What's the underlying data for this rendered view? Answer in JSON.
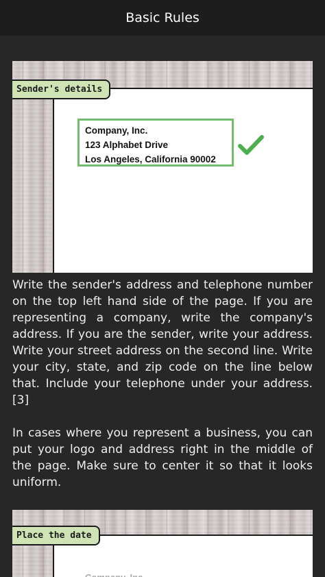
{
  "app_bar": {
    "title": "Basic Rules"
  },
  "sections": [
    {
      "tag": "Sender's details",
      "address_lines": [
        "Company, Inc.",
        "123 Alphabet Drive",
        "Los Angeles, California 90002"
      ],
      "check_icon": "checkmark-icon",
      "paragraphs": [
        "Write the sender's address and telephone number on the top left hand side of the page. If you are representing a company, write the company's address. If you are the sender, write your address. Write your street address on the second line. Write your city, state, and zip code on the line below that. Include your telephone under your address.[3]",
        "In cases where you represent a business, you can put your logo and address right in the middle of the page. Make sure to center it so that it looks uniform."
      ]
    },
    {
      "tag": "Place the date",
      "address_lines": [
        "Company, Inc."
      ]
    }
  ],
  "colors": {
    "accent_green": "#6fbe6e",
    "tag_bg": "#cfe3b4",
    "app_bar_bg": "#1d1d1d",
    "page_bg": "#272727"
  }
}
